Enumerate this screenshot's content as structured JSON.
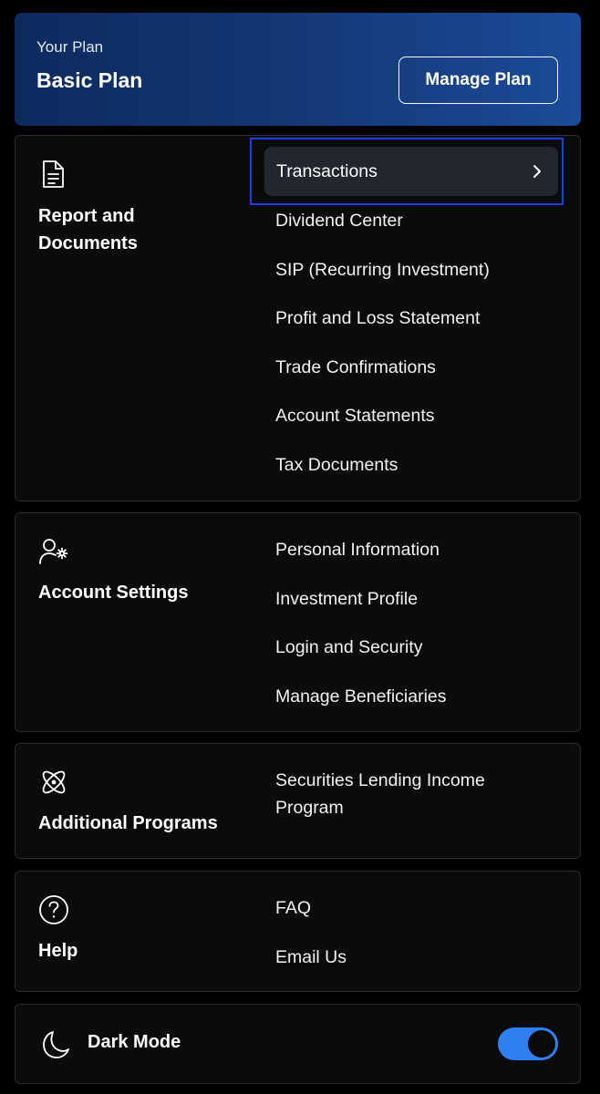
{
  "plan": {
    "caption": "Your Plan",
    "name": "Basic Plan",
    "manage_label": "Manage Plan"
  },
  "reports": {
    "title": "Report and Documents",
    "icon": "document-icon",
    "items": [
      "Transactions",
      "Dividend Center",
      "SIP (Recurring Investment)",
      "Profit and Loss Statement",
      "Trade Confirmations",
      "Account Statements",
      "Tax Documents"
    ]
  },
  "account": {
    "title": "Account Settings",
    "icon": "user-settings-icon",
    "items": [
      "Personal Information",
      "Investment Profile",
      "Login and Security",
      "Manage Beneficiaries"
    ]
  },
  "programs": {
    "title": "Additional Programs",
    "icon": "atom-icon",
    "items": [
      "Securities Lending Income Program"
    ]
  },
  "help": {
    "title": "Help",
    "icon": "question-circle-icon",
    "items": [
      "FAQ",
      "Email Us"
    ]
  },
  "dark_mode": {
    "label": "Dark Mode",
    "icon": "moon-icon",
    "enabled": true
  },
  "colors": {
    "background": "#000000",
    "plan_gradient_start": "#0c2a5c",
    "plan_gradient_end": "#1c4b98",
    "highlight_border": "#1d3fe0",
    "toggle_on": "#2f7ff0"
  }
}
